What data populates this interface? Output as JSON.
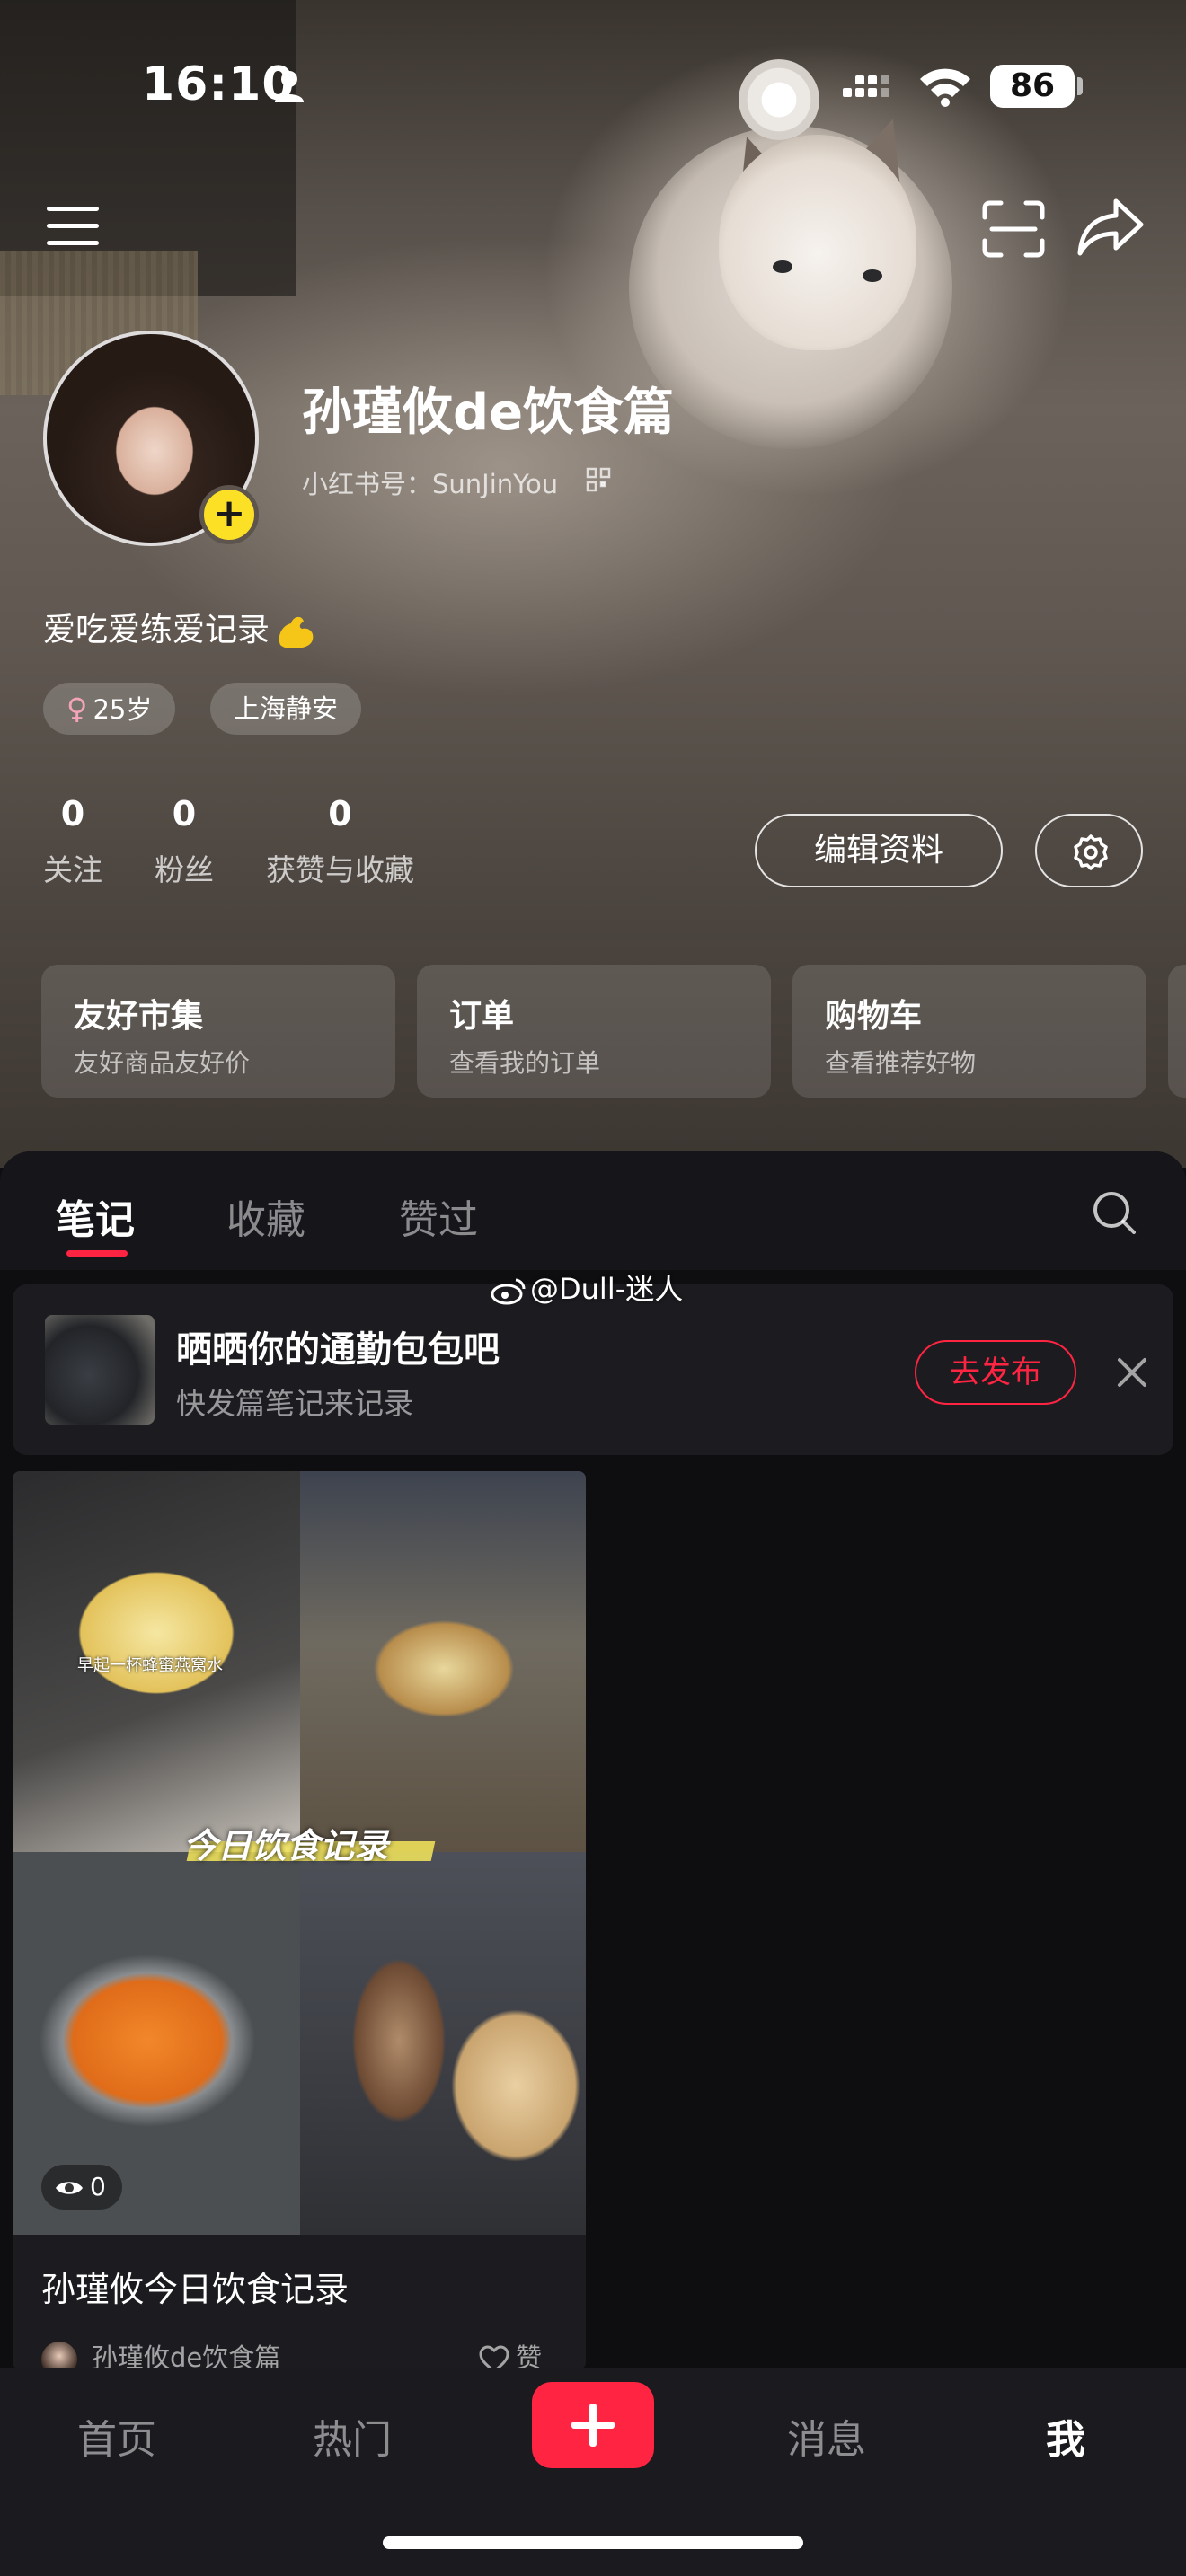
{
  "status_bar": {
    "time": "16:10",
    "battery": "86"
  },
  "profile": {
    "nickname": "孙瑾攸de饮食篇",
    "red_id": "小红书号：SunJinYou",
    "bio": "爱吃爱练爱记录",
    "age_tag": "25岁",
    "location_tag": "上海静安",
    "avatar_plus": "+"
  },
  "stats": [
    {
      "value": "0",
      "label": "关注"
    },
    {
      "value": "0",
      "label": "粉丝"
    },
    {
      "value": "0",
      "label": "获赞与收藏"
    }
  ],
  "buttons": {
    "edit_profile": "编辑资料"
  },
  "cards": [
    {
      "title": "友好市集",
      "subtitle": "友好商品友好价"
    },
    {
      "title": "订单",
      "subtitle": "查看我的订单"
    },
    {
      "title": "购物车",
      "subtitle": "查看推荐好物"
    }
  ],
  "tabs": [
    {
      "label": "笔记",
      "active": true
    },
    {
      "label": "收藏",
      "active": false
    },
    {
      "label": "赞过",
      "active": false
    }
  ],
  "watermark": "@Dull-迷人",
  "promo": {
    "title": "晒晒你的通勤包包吧",
    "subtitle": "快发篇笔记来记录",
    "button": "去发布"
  },
  "note": {
    "image_text_small": "早起一杯蜂蜜燕窝水",
    "image_banner": "今日饮食记录",
    "views": "0",
    "title": "孙瑾攸今日饮食记录",
    "author": "孙瑾攸de饮食篇",
    "like_label": "赞"
  },
  "bottom_nav": [
    {
      "label": "首页",
      "active": false
    },
    {
      "label": "热门",
      "active": false
    },
    {
      "label": "消息",
      "active": false
    },
    {
      "label": "我",
      "active": true
    }
  ],
  "colors": {
    "accent": "#ff2442",
    "avatar_plus": "#fce025",
    "panel_bg": "#0e0e10"
  },
  "icons": [
    "person-icon",
    "signal-icon",
    "wifi-icon",
    "menu-icon",
    "scan-icon",
    "share-icon",
    "qr-code-icon",
    "muscle-emoji-icon",
    "female-icon",
    "settings-icon",
    "search-icon",
    "weibo-icon",
    "close-icon",
    "eye-icon",
    "heart-icon",
    "plus-icon"
  ]
}
